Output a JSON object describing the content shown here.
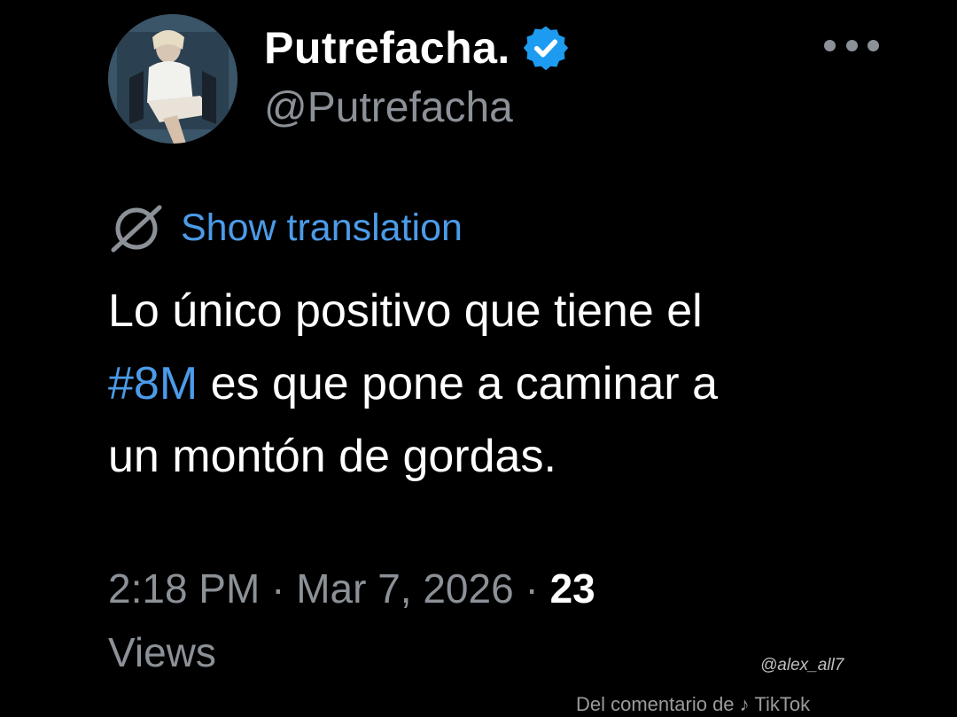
{
  "author": {
    "display_name": "Putrefacha.",
    "handle": "@Putrefacha",
    "verified": true
  },
  "translation": {
    "link_label": "Show translation"
  },
  "tweet": {
    "line1": "Lo único positivo que tiene el",
    "hashtag": "#8M",
    "line2_rest": " es que pone a caminar a",
    "line3": "un montón de gordas."
  },
  "meta": {
    "time": "2:18 PM",
    "sep1": " · ",
    "date": "Mar 7, 2026",
    "sep2": " · ",
    "views_count": "23",
    "views_label": "Views"
  },
  "watermark": {
    "handle": "@alex_all7",
    "source": "Del comentario de ♪ TikTok"
  },
  "icons": {
    "avatar": "profile-photo",
    "verified": "verified-badge-icon",
    "more": "more-options-icon",
    "translate": "translate-globe-icon"
  },
  "colors": {
    "background": "#000000",
    "text": "#ffffff",
    "secondary": "#8b9197",
    "accent": "#4c9be8",
    "verified": "#1d9bf0"
  }
}
